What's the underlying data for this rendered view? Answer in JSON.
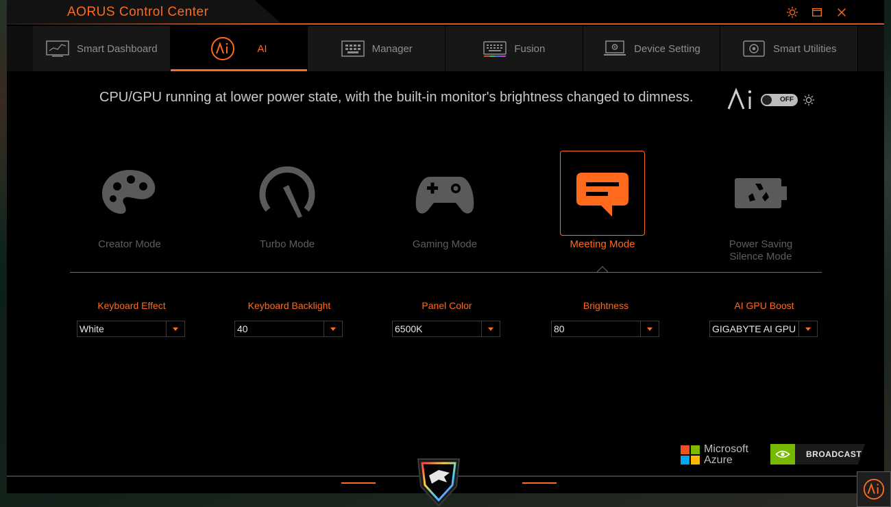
{
  "window": {
    "title": "AORUS Control Center"
  },
  "tabs": [
    {
      "label": "Smart Dashboard",
      "icon": "dashboard-icon"
    },
    {
      "label": "AI",
      "icon": "ai-icon",
      "active": true
    },
    {
      "label": "Manager",
      "icon": "manager-icon"
    },
    {
      "label": "Fusion",
      "icon": "keyboard-icon"
    },
    {
      "label": "Device Setting",
      "icon": "device-setting-icon"
    },
    {
      "label": "Smart Utilities",
      "icon": "smart-utilities-icon"
    }
  ],
  "description": "CPU/GPU running at lower power state, with the built-in monitor's brightness changed to dimness.",
  "ai_toggle": {
    "state_text": "OFF"
  },
  "modes": [
    {
      "label": "Creator Mode",
      "icon": "palette-icon"
    },
    {
      "label": "Turbo Mode",
      "icon": "speedometer-icon"
    },
    {
      "label": "Gaming Mode",
      "icon": "gamepad-icon"
    },
    {
      "label": "Meeting Mode",
      "icon": "chat-icon",
      "active": true
    },
    {
      "label": "Power Saving Silence Mode",
      "label_line1": "Power Saving",
      "label_line2": "Silence Mode",
      "icon": "eco-battery-icon"
    }
  ],
  "settings": [
    {
      "label": "Keyboard Effect",
      "value": "White"
    },
    {
      "label": "Keyboard Backlight",
      "value": "40"
    },
    {
      "label": "Panel Color",
      "value": "6500K"
    },
    {
      "label": "Brightness",
      "value": "80"
    },
    {
      "label": "AI GPU Boost",
      "value": "GIGABYTE AI GPU"
    }
  ],
  "partners": {
    "microsoft_line1": "Microsoft",
    "microsoft_line2": "Azure",
    "nvidia": "BROADCAST"
  },
  "colors": {
    "accent": "#ff6a1c",
    "inactive": "#5e5e5e",
    "background": "#000000"
  }
}
